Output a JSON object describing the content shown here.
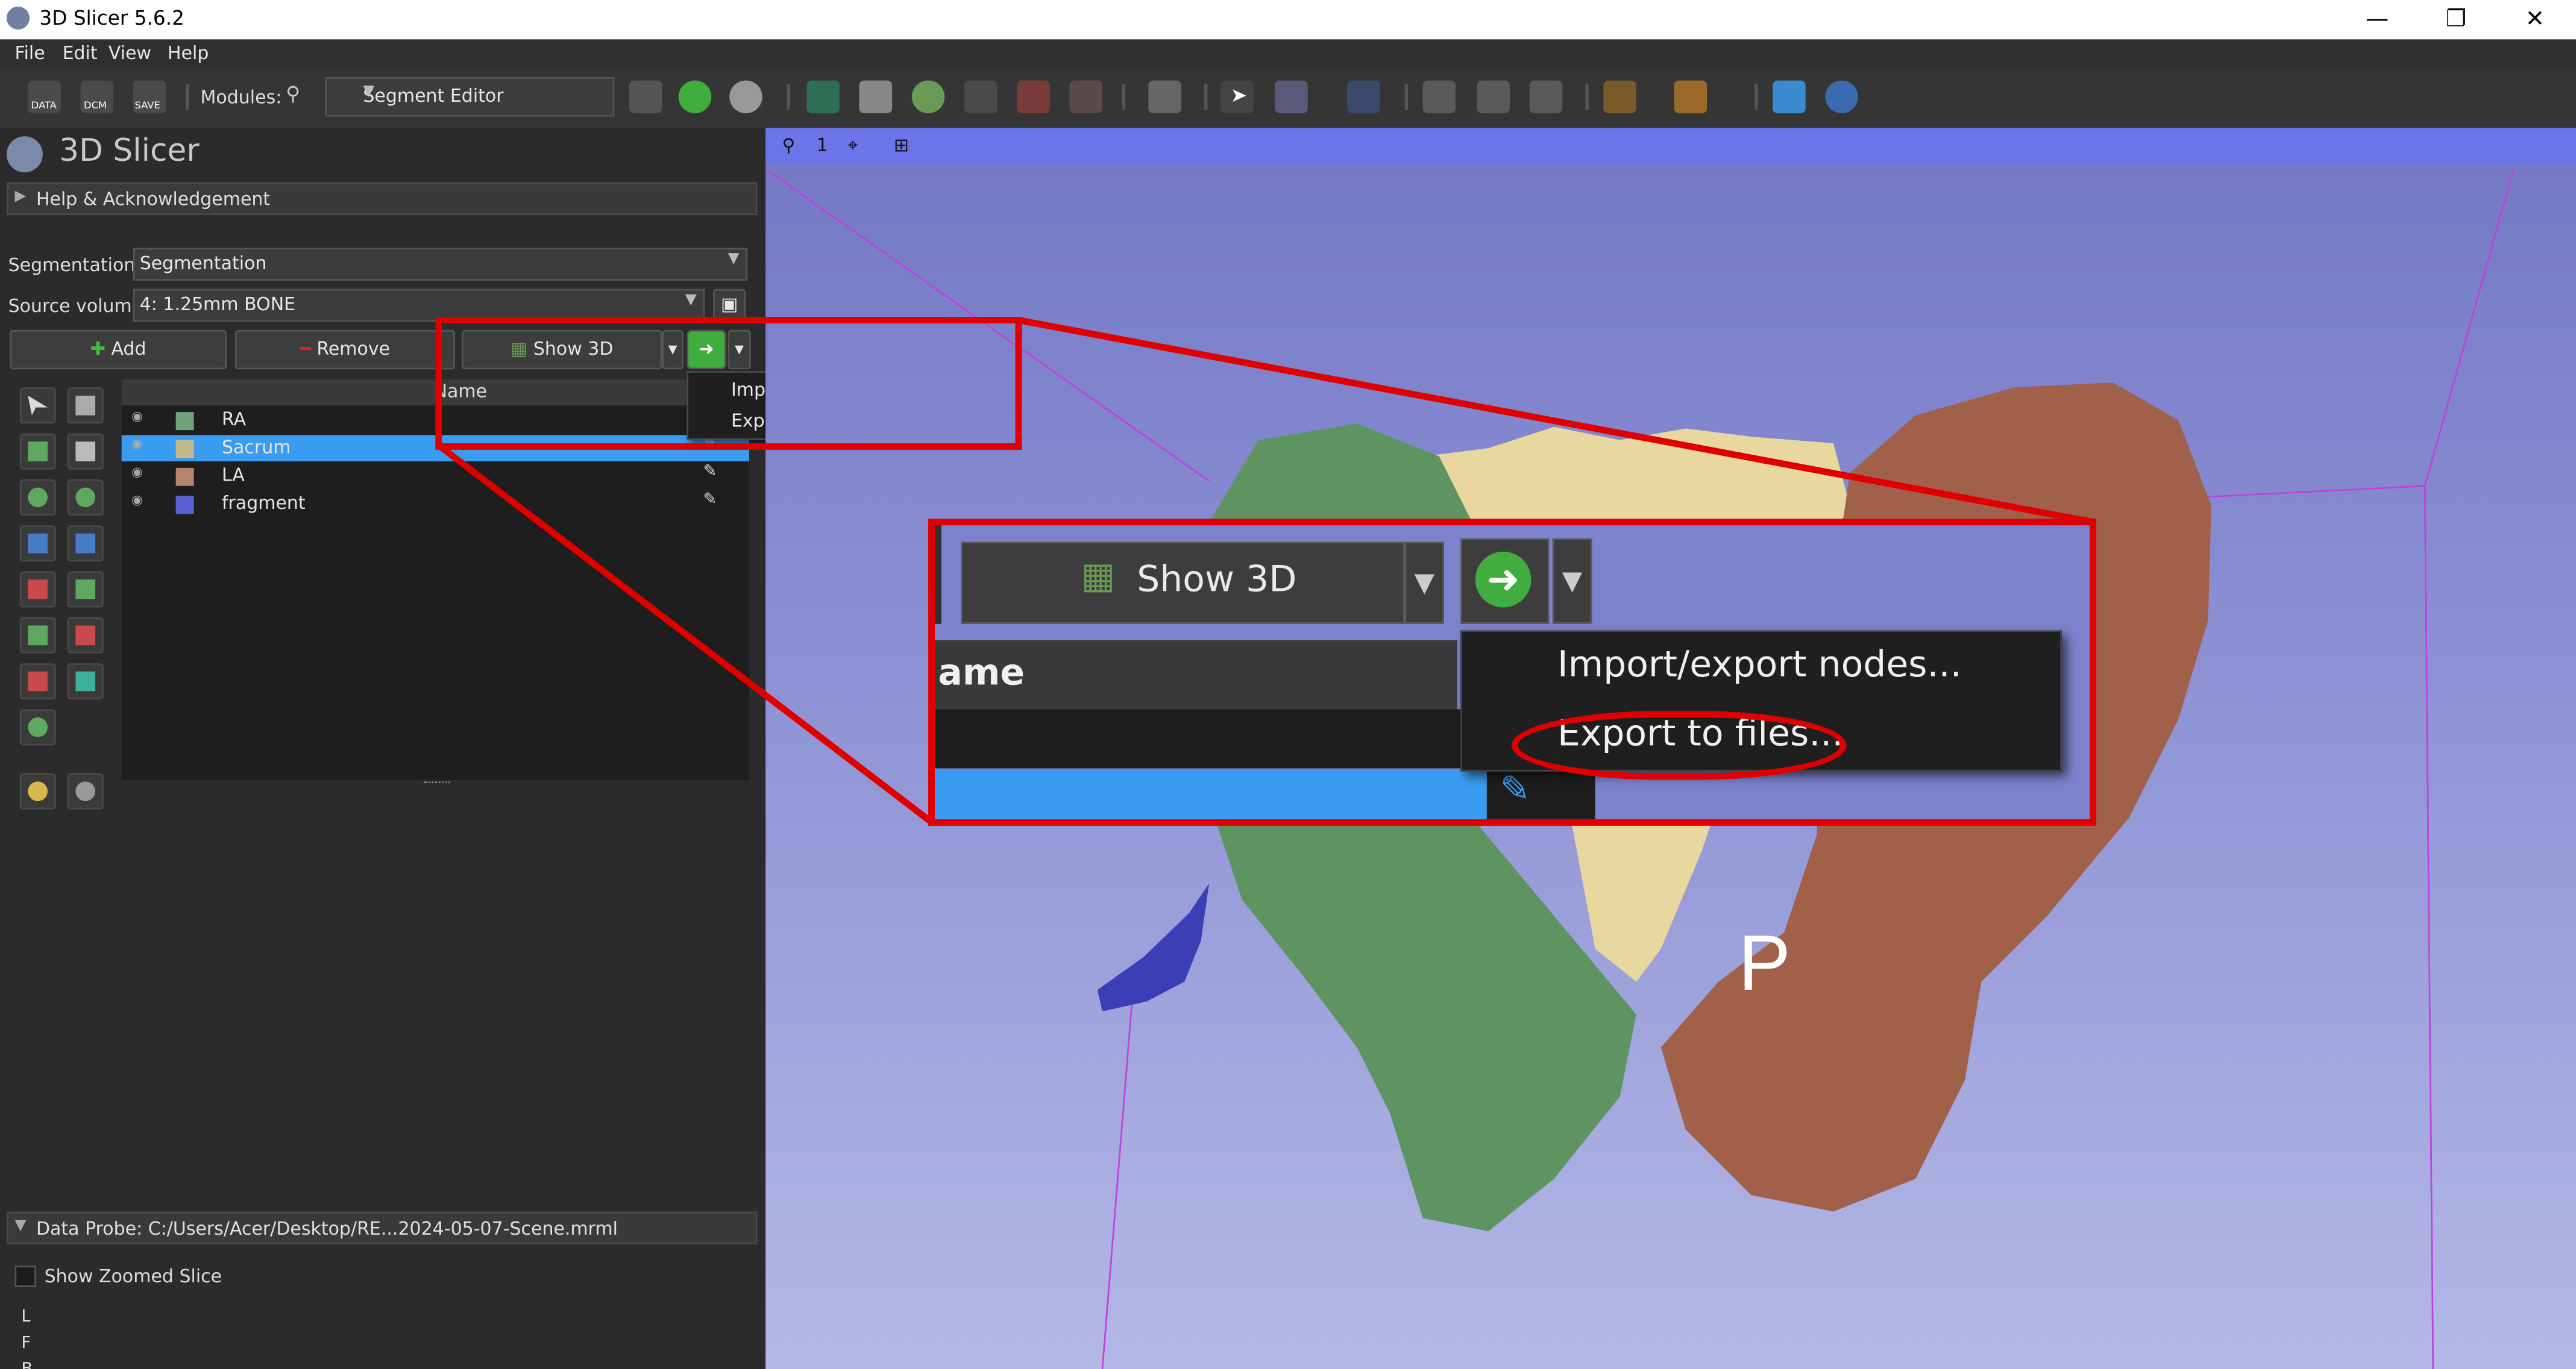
{
  "window": {
    "title": "3D Slicer 5.6.2",
    "minimize": "—",
    "maximize": "❐",
    "close": "✕"
  },
  "menubar": [
    "File",
    "Edit",
    "View",
    "Help"
  ],
  "toolbar": {
    "modules_label": "Modules:",
    "module_selected": "Segment Editor",
    "data_label": "DATA",
    "dcm_label": "DCM",
    "save_label": "SAVE"
  },
  "left_panel": {
    "app_title": "3D Slicer",
    "help_section": "Help & Acknowledgement",
    "segmentation_label": "Segmentation:",
    "segmentation_value": "Segmentation",
    "source_volume_label": "Source volume:",
    "source_volume_value": "4: 1.25mm BONE",
    "add_button": "Add",
    "remove_button": "Remove",
    "show3d_button": "Show 3D",
    "table_header_name": "Name",
    "segments": [
      {
        "name": "RA",
        "color": "#6fa37a",
        "selected": false
      },
      {
        "name": "Sacrum",
        "color": "#c2b88c",
        "selected": true
      },
      {
        "name": "LA",
        "color": "#b7826e",
        "selected": false
      },
      {
        "name": "fragment",
        "color": "#5a5fd0",
        "selected": false
      }
    ],
    "popup_menu": [
      "Import/export nodes...",
      "Export to files..."
    ],
    "data_probe": "Data Probe: C:/Users/Acer/Desktop/RE...2024-05-07-Scene.mrml",
    "show_zoomed_slice": "Show Zoomed Slice",
    "probe_lines": [
      "L",
      "F",
      "B"
    ]
  },
  "view3d": {
    "layout_number": "1",
    "orientation_letter": "P",
    "zoom": {
      "show3d": "Show 3D",
      "header_fragment": "ame",
      "menu_items": [
        "Import/export nodes...",
        "Export to files..."
      ]
    }
  },
  "colors": {
    "highlight": "#3a9cf0",
    "red_annotation": "#e00000",
    "green_arrow": "#3fae3f",
    "view_bar": "#6b74e8"
  }
}
